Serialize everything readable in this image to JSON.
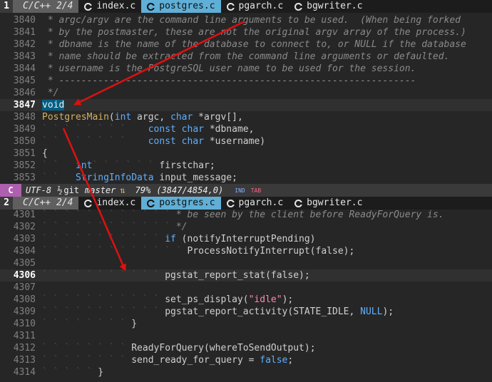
{
  "top_tabbar": {
    "number": "1",
    "lang": "C/C++ 2/4",
    "tabs": [
      {
        "label": "index.c",
        "active": false
      },
      {
        "label": "postgres.c",
        "active": true
      },
      {
        "label": "pgarch.c",
        "active": false
      },
      {
        "label": "bgwriter.c",
        "active": false
      }
    ]
  },
  "bottom_tabbar": {
    "number": "2",
    "lang": "C/C++ 2/4",
    "tabs": [
      {
        "label": "index.c",
        "active": false
      },
      {
        "label": "postgres.c",
        "active": true
      },
      {
        "label": "pgarch.c",
        "active": false
      },
      {
        "label": "bgwriter.c",
        "active": false
      }
    ]
  },
  "top_pane": {
    "lines": [
      {
        "num": "3840",
        "indent": "",
        "code": " * argc/argv are the command line arguments to be used.  (When being forked",
        "style": "cm"
      },
      {
        "num": "3841",
        "indent": "",
        "code": " * by the postmaster, these are not the original argv array of the process.)",
        "style": "cm"
      },
      {
        "num": "3842",
        "indent": "",
        "code": " * dbname is the name of the database to connect to, or NULL if the database",
        "style": "cm"
      },
      {
        "num": "3843",
        "indent": "",
        "code": " * name should be extracted from the command line arguments or defaulted.",
        "style": "cm"
      },
      {
        "num": "3844",
        "indent": "",
        "code": " * username is the PostgreSQL user name to be used for the session.",
        "style": "cm"
      },
      {
        "num": "3845",
        "indent": "",
        "code": " * ----------------------------------------------------------------",
        "style": "cm"
      },
      {
        "num": "3846",
        "indent": "",
        "code": " */",
        "style": "cm"
      },
      {
        "num": "3847",
        "indent": "",
        "code": "void",
        "style": "kw-hl",
        "current": true
      },
      {
        "num": "3848",
        "indent": "",
        "code": "PostgresMain(int argc, char *argv[],",
        "style": "main"
      },
      {
        "num": "3849",
        "indent": "` ` ` ` ` ` ` ` ",
        "code": "   const char *dbname,",
        "style": "decl"
      },
      {
        "num": "3850",
        "indent": "` ` ` ` ` ` ` ` ",
        "code": "   const char *username)",
        "style": "decl"
      },
      {
        "num": "3851",
        "indent": "",
        "code": "{",
        "style": "plain"
      },
      {
        "num": "3852",
        "indent": "` ` ",
        "code": "  int` ` ` ` ` ` firstchar;",
        "style": "var"
      },
      {
        "num": "3853",
        "indent": "` ` ",
        "code": "  StringInfoData input_message;",
        "style": "var2"
      }
    ]
  },
  "status_bar": {
    "mode": "C",
    "encoding": "UTF-8",
    "format_icon": "½",
    "branch_prefix": "git",
    "branch": "master",
    "branch_icon": "⇅",
    "percent": "79%",
    "position": "(3847/4854,0)",
    "ind": "IND",
    "tab": "TAB"
  },
  "bottom_pane": {
    "lines": [
      {
        "num": "4301",
        "code": "` ` ` ` ` ` ` ` ` ` ` ` * be seen by the client before ReadyForQuery is.",
        "style": "cmi"
      },
      {
        "num": "4302",
        "code": "` ` ` ` ` ` ` ` ` ` ` ` */",
        "style": "cmi"
      },
      {
        "num": "4303",
        "code": "` ` ` ` ` ` ` ` ` ` ` if (notifyInterruptPending)",
        "style": "if"
      },
      {
        "num": "4304",
        "code": "` ` ` ` ` ` ` ` ` ` ` ` ` ProcessNotifyInterrupt(false);",
        "style": "call"
      },
      {
        "num": "4305",
        "code": "",
        "style": "plain"
      },
      {
        "num": "4306",
        "code": "` ` ` ` ` ` ` ` ` ` ` pgstat_report_stat(false);",
        "style": "call",
        "current": true
      },
      {
        "num": "4307",
        "code": "",
        "style": "plain"
      },
      {
        "num": "4308",
        "code": "` ` ` ` ` ` ` ` ` ` ` set_ps_display(\"idle\");",
        "style": "str"
      },
      {
        "num": "4309",
        "code": "` ` ` ` ` ` ` ` ` ` ` pgstat_report_activity(STATE_IDLE, NULL);",
        "style": "null"
      },
      {
        "num": "4310",
        "code": "` ` ` ` ` ` ` ` }",
        "style": "plain"
      },
      {
        "num": "4311",
        "code": "",
        "style": "plain"
      },
      {
        "num": "4312",
        "code": "` ` ` ` ` ` ` ` ReadyForQuery(whereToSendOutput);",
        "style": "plain"
      },
      {
        "num": "4313",
        "code": "` ` ` ` ` ` ` ` send_ready_for_query = false;",
        "style": "false"
      },
      {
        "num": "4314",
        "code": "` ` ` ` ` }",
        "style": "plain"
      }
    ]
  },
  "colors": {
    "background": "#262626",
    "active_tab": "#5fafd7",
    "mode_badge": "#af5faf",
    "arrow": "#e01010",
    "keyword": "#5fafff",
    "function": "#d7af5f",
    "string": "#ff87af"
  }
}
